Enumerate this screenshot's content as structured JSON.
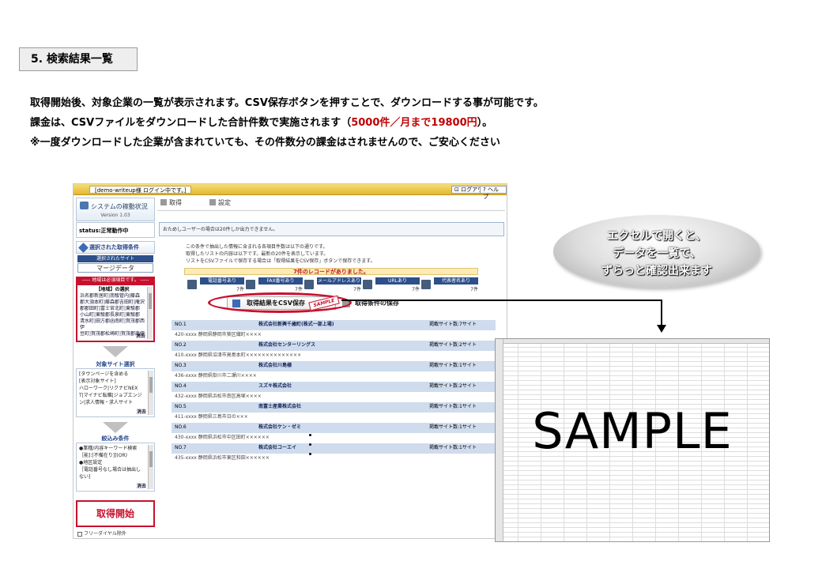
{
  "section": {
    "title": "5. 検索結果一覧"
  },
  "intro": {
    "line1": "取得開始後、対象企業の一覧が表示されます。CSV保存ボタンを押すことで、ダウンロードする事が可能です。",
    "line2_pre": "課金は、CSVファイルをダウンロードした合計件数で実施されます（",
    "line2_red": "5000件／月まで19800円",
    "line2_post": "）。",
    "line3": "※一度ダウンロードした企業が含まれていても、その件数分の課金はされませんので、ご安心ください"
  },
  "app": {
    "login_text": "[demo-writeup様 ログイン中です。]",
    "logout_label": "ログアウト",
    "help_label": "ヘルプ",
    "status_title": "システムの稼動状況",
    "version": "Version 1.03",
    "status_value": "status:正常動作中",
    "conditions_title": "選択された取得条件",
    "selected_site_label": "選択されたサイト",
    "selected_site_value": "マージデータ",
    "area_notice": "----- 地域は必須項目です。 -----",
    "area_heading": "【地域】の選択",
    "area_lines": [
      "浜名郡新居町|南駿管内|藤森",
      "郡大須本町|藤森郡吉田町|庵沢",
      "郡郡田町|富士宮北町|東駿郡",
      "小山町|東駿郡長泉町|東駿郡",
      "清水町|田方郡函南町|賀茂郡西伊",
      "豆町|賀茂郡松崎町|賀茂郡南伊"
    ],
    "area_link": "消去",
    "target_title": "対象サイト選択",
    "target_lines": [
      "[タウンページを含める",
      "",
      "[表示対象サイト]",
      "ハローワーク|リクナビNEX",
      "T|マイナビ転職|ジョブエンジ",
      "ン|求人情報・求人サイト"
    ],
    "target_link": "消去",
    "refine_title": "絞込み条件",
    "refine_lines": [
      "●業種/内容キーワード検索",
      "［能]:[不備在り]](OR)",
      "",
      "●地区設定",
      "［電話番号なし場合は抽出し",
      "ない]"
    ],
    "refine_link": "消去",
    "start_label": "取得開始",
    "free_dial_label": "フリーダイヤル除外",
    "tab_get": "取得",
    "tab_settings": "設定",
    "notice": "おためしユーザーの場合は20件しか出力できません。",
    "messages": [
      "この条件で抽出した情報に含まれる各項目件数は以下の通りです。",
      "取得したリストの内容は以下です。最新の20件を表示しています。",
      "リストをCSVファイルで保存する場合は「取得結果をCSV保存」ボタンで保存できます。"
    ],
    "found_text": "7件のレコードがありました。",
    "columns": [
      {
        "label": "電話番号あり",
        "count": "7件"
      },
      {
        "label": "FAX番号あり",
        "count": "7件"
      },
      {
        "label": "メールアドレスあり",
        "count": "7件"
      },
      {
        "label": "URLあり",
        "count": "7件"
      },
      {
        "label": "代表者名あり",
        "count": "7件"
      }
    ],
    "csv_save_label": "取得結果をCSV保存",
    "stamp_text": "SAMPLE",
    "save_cond_label": "取得条件の保存",
    "results": [
      {
        "no": "NO.1",
        "name": "株式会社新興千歳町(株式一部上場)",
        "meta": "掲載サイト数:7サイト",
        "addr": "420-xxxx 静岡県静岡市葵区織町××××"
      },
      {
        "no": "NO.2",
        "name": "株式会社センターリングス",
        "meta": "掲載サイト数:2サイト",
        "addr": "410-xxxx 静岡県沼津市高島本町××××××××××××××"
      },
      {
        "no": "NO.3",
        "name": "株式会社川島様",
        "meta": "掲載サイト数:1サイト",
        "addr": "436-xxxx 静岡県掛川市二瀬川××××"
      },
      {
        "no": "NO.4",
        "name": "スズキ株式会社",
        "meta": "掲載サイト数:2サイト",
        "addr": "432-xxxx 静岡県浜松市南区高塚××××"
      },
      {
        "no": "NO.5",
        "name": "南富士産業株式会社",
        "meta": "掲載サイト数:1サイト",
        "addr": "411-xxxx 静岡県三島市日の×××"
      },
      {
        "no": "NO.6",
        "name": "株式会社ケン・ゼミ",
        "meta": "掲載サイト数:1サイト",
        "addr": "430-xxxx 静岡県浜松市中区田町××××××"
      },
      {
        "no": "NO.7",
        "name": "株式会社コーエイ",
        "meta": "掲載サイト数:1サイト",
        "addr": "435-xxxx 静岡県浜松市東区和田××××××"
      }
    ]
  },
  "callout": {
    "line1": "エクセルで開くと、",
    "line2": "データを一覧で、",
    "line3": "ずらっと確認出来ます"
  },
  "sheet": {
    "watermark": "SAMPLE"
  }
}
